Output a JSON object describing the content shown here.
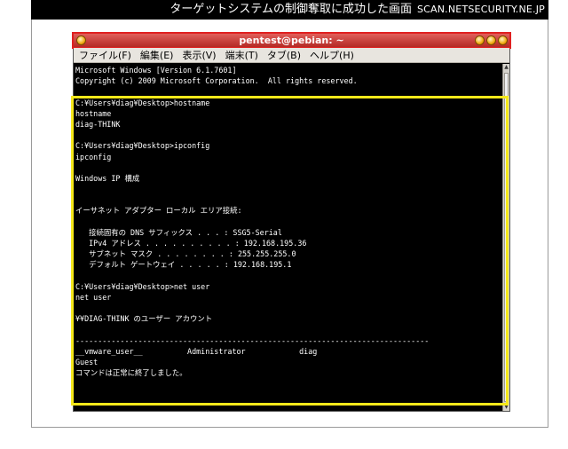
{
  "caption": {
    "title": "ターゲットシステムの制御奪取に成功した画面",
    "site": "SCAN.NETSECURITY.NE.JP"
  },
  "window": {
    "title": "pentest@pebian: ~"
  },
  "menubar": {
    "items": [
      "ファイル(F)",
      "編集(E)",
      "表示(V)",
      "端末(T)",
      "タブ(B)",
      "ヘルプ(H)"
    ]
  },
  "terminal": {
    "lines": [
      "Microsoft Windows [Version 6.1.7601]",
      "Copyright (c) 2009 Microsoft Corporation.  All rights reserved.",
      "",
      "C:¥Users¥diag¥Desktop>hostname",
      "hostname",
      "diag-THINK",
      "",
      "C:¥Users¥diag¥Desktop>ipconfig",
      "ipconfig",
      "",
      "Windows IP 構成",
      "",
      "",
      "イーサネット アダプター ローカル エリア接続:",
      "",
      "   接続固有の DNS サフィックス . . . : SSG5-Serial",
      "   IPv4 アドレス . . . . . . . . . . : 192.168.195.36",
      "   サブネット マスク . . . . . . . . : 255.255.255.0",
      "   デフォルト ゲートウェイ . . . . . : 192.168.195.1",
      "",
      "C:¥Users¥diag¥Desktop>net user",
      "net user",
      "",
      "¥¥DIAG-THINK のユーザー アカウント",
      "",
      "-------------------------------------------------------------------------------",
      "__vmware_user__          Administrator            diag",
      "Guest",
      "コマンドは正常に終了しました。",
      ""
    ]
  },
  "colors": {
    "highlight": "#f5e81a",
    "titlebar_outline": "#e02020",
    "terminal_bg": "#000000",
    "terminal_fg": "#ffffff"
  },
  "icons": {
    "window_menu": "orb-menu-icon",
    "minimize": "minimize-icon",
    "maximize": "maximize-icon",
    "close": "close-icon"
  }
}
